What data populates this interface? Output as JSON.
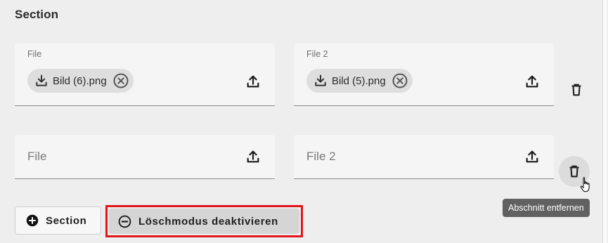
{
  "section": {
    "title": "Section"
  },
  "rows": [
    {
      "fields": [
        {
          "label": "File",
          "file": "Bild (6).png"
        },
        {
          "label": "File 2",
          "file": "Bild (5).png"
        }
      ]
    },
    {
      "fields": [
        {
          "placeholder": "File"
        },
        {
          "placeholder": "File 2"
        }
      ]
    }
  ],
  "tooltip": {
    "text": "Abschnitt entfernen"
  },
  "buttons": {
    "add_section_label": "Section",
    "delete_mode_label": "Löschmodus deaktivieren"
  },
  "colors": {
    "highlight": "#e0161b",
    "tooltip_bg": "#616161",
    "field_bg": "#f5f5f5",
    "page_bg": "#eeeeee"
  },
  "icons": {
    "chip_leading": "download-icon",
    "chip_trailing": "remove-circle-icon",
    "field_action": "upload-icon",
    "row_action": "trash-icon",
    "add_button": "add-circle-icon",
    "delete_mode_button": "minus-circle-icon"
  }
}
